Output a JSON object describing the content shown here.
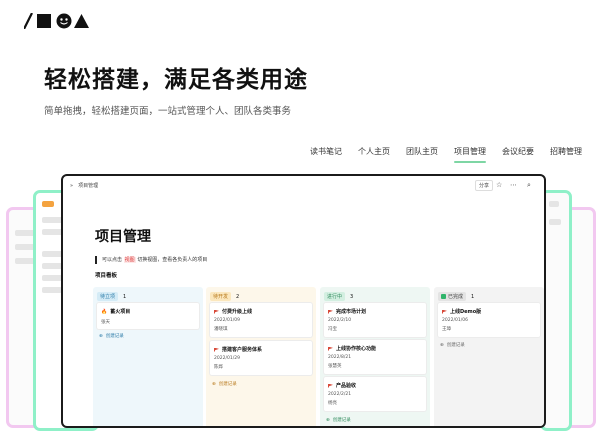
{
  "hero": {
    "title": "轻松搭建，满足各类用途",
    "subtitle": "简单拖拽，轻松搭建页面，一站式管理个人、团队各类事务"
  },
  "tabs": [
    {
      "label": "读书笔记",
      "active": false
    },
    {
      "label": "个人主页",
      "active": false
    },
    {
      "label": "团队主页",
      "active": false
    },
    {
      "label": "项目管理",
      "active": true
    },
    {
      "label": "会议纪要",
      "active": false
    },
    {
      "label": "招聘管理",
      "active": false
    }
  ],
  "window": {
    "breadcrumb": "项目管理",
    "share_label": "分享",
    "page_title": "项目管理",
    "quote_prefix": "可以点击",
    "quote_highlight": "视图",
    "quote_suffix": "切换视图，查看各负责人的项目",
    "board_label": "项目看板",
    "columns": [
      {
        "status": "待立项",
        "count": "1",
        "cards": [
          {
            "title": "蓄火项目",
            "lines": [
              "张天"
            ]
          }
        ],
        "add_label": "创建记录"
      },
      {
        "status": "待开发",
        "count": "2",
        "cards": [
          {
            "title": "付费升级上线",
            "lines": [
              "2022/01/09",
              "潘晓琪"
            ]
          },
          {
            "title": "搭建客户服务体系",
            "lines": [
              "2022/01/29",
              "陈烨"
            ]
          }
        ],
        "add_label": "创建记录"
      },
      {
        "status": "进行中",
        "count": "3",
        "cards": [
          {
            "title": "完成市场计划",
            "lines": [
              "2022/2/10",
              "冯宝"
            ]
          },
          {
            "title": "上线协作核心功能",
            "lines": [
              "2022/8/21",
              "张慧英"
            ]
          },
          {
            "title": "产品验收",
            "lines": [
              "2022/2/21",
              "杨亮"
            ]
          }
        ],
        "add_label": "创建记录"
      },
      {
        "status": "已完成",
        "count": "1",
        "cards": [
          {
            "title": "上线Demo版",
            "lines": [
              "2022/01/06",
              "王璋"
            ]
          }
        ],
        "add_label": "创建记录"
      }
    ]
  },
  "colors": {
    "accent": "#7ed6a4",
    "window_border": "#1b1b1b",
    "back_green": "#8ff0c8",
    "back_pink": "#f2c8f0",
    "col_todo_bg": "#eef7fb",
    "col_dev_bg": "#fdf7ea",
    "col_doing_bg": "#eef7f3",
    "col_done_bg": "#f3f3f3",
    "flag": "#d84a3a"
  },
  "icons": [
    "logo-slash",
    "logo-square",
    "logo-smile",
    "logo-triangle",
    "sidebar-toggle-icon",
    "more-icon",
    "star-icon",
    "search-icon",
    "flag-icon",
    "fire-icon",
    "check-icon",
    "plus-icon"
  ]
}
